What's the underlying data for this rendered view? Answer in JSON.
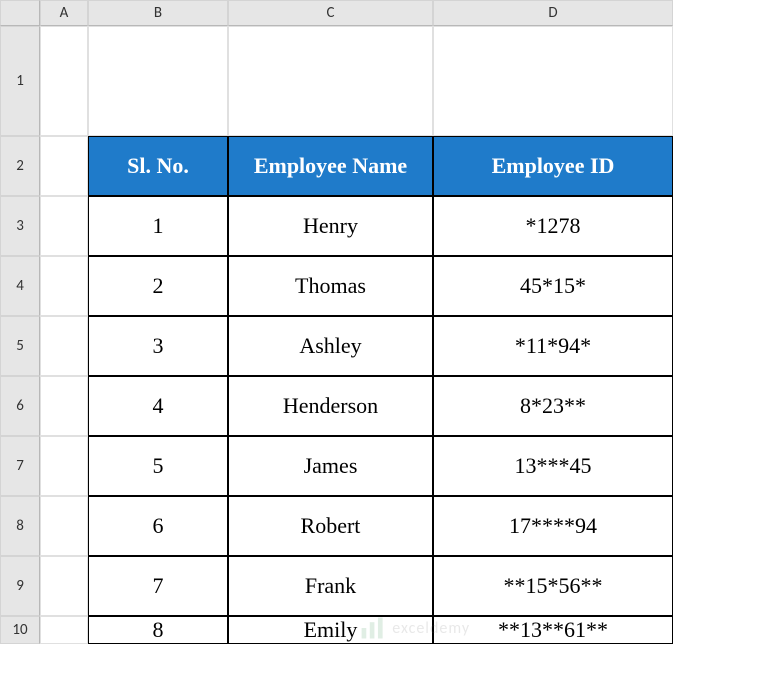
{
  "columns": [
    "",
    "A",
    "B",
    "C",
    "D"
  ],
  "rows": [
    "1",
    "2",
    "3",
    "4",
    "5",
    "6",
    "7",
    "8",
    "9",
    "10"
  ],
  "headers": {
    "sl_no": "Sl. No.",
    "emp_name": "Employee Name",
    "emp_id": "Employee ID"
  },
  "chart_data": {
    "type": "table",
    "title": "",
    "columns": [
      "Sl. No.",
      "Employee Name",
      "Employee ID"
    ],
    "rows": [
      {
        "sl_no": "1",
        "name": "Henry",
        "id": "*1278"
      },
      {
        "sl_no": "2",
        "name": "Thomas",
        "id": "45*15*"
      },
      {
        "sl_no": "3",
        "name": "Ashley",
        "id": "*11*94*"
      },
      {
        "sl_no": "4",
        "name": "Henderson",
        "id": "8*23**"
      },
      {
        "sl_no": "5",
        "name": "James",
        "id": "13***45"
      },
      {
        "sl_no": "6",
        "name": "Robert",
        "id": "17****94"
      },
      {
        "sl_no": "7",
        "name": "Frank",
        "id": "**15*56**"
      },
      {
        "sl_no": "8",
        "name": "Emily",
        "id": "**13**61**"
      }
    ]
  },
  "watermark": "exceldemy"
}
